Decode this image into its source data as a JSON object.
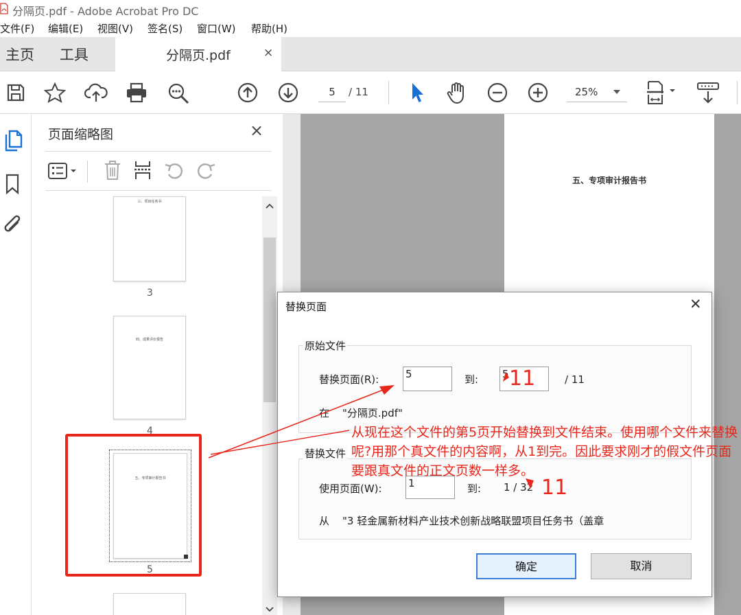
{
  "window": {
    "title": "分隔页.pdf - Adobe Acrobat Pro DC"
  },
  "menu": [
    "文件(F)",
    "编辑(E)",
    "视图(V)",
    "签名(S)",
    "窗口(W)",
    "帮助(H)"
  ],
  "tabs": {
    "home": "主页",
    "tools": "工具",
    "document": "分隔页.pdf",
    "close": "×"
  },
  "toolbar": {
    "page_current": "5",
    "page_total": "/ 11",
    "zoom": "25%"
  },
  "thumbnails": {
    "title": "页面缩略图",
    "close": "×",
    "pages": [
      {
        "number": "3",
        "heading": "三、项目任务书"
      },
      {
        "number": "4",
        "heading": "四、成果评价报告"
      },
      {
        "number": "5",
        "heading": "五、专项审计报告书"
      }
    ]
  },
  "document": {
    "page_heading": "五、专项审计报告书"
  },
  "dialog": {
    "title": "替换页面",
    "close": "✕",
    "original_group": "原始文件",
    "replace_label": "替换页面(R):",
    "replace_from": "5",
    "to_label": "到:",
    "replace_to": "5",
    "total": "/ 11",
    "in_label": "在",
    "in_file": "\"分隔页.pdf\"",
    "replacement_group": "替换文件",
    "use_label": "使用页面(W):",
    "use_from": "1",
    "use_to_label": "到:",
    "use_to": "1 / 32",
    "from_label": "从",
    "from_file": "\"3 轻金属新材料产业技术创新战略联盟项目任务书（盖章",
    "ok": "确定",
    "cancel": "取消"
  },
  "annotation": {
    "text": "从现在这个文件的第5页开始替换到文件结束。使用哪个文件来替换呢?用那个真文件的内容啊，从1到完。因此要求刚才的假文件页面要跟真文件的正文页数一样多。",
    "to_value": "11",
    "use_to_value": "11",
    "color": "#e8271c"
  }
}
